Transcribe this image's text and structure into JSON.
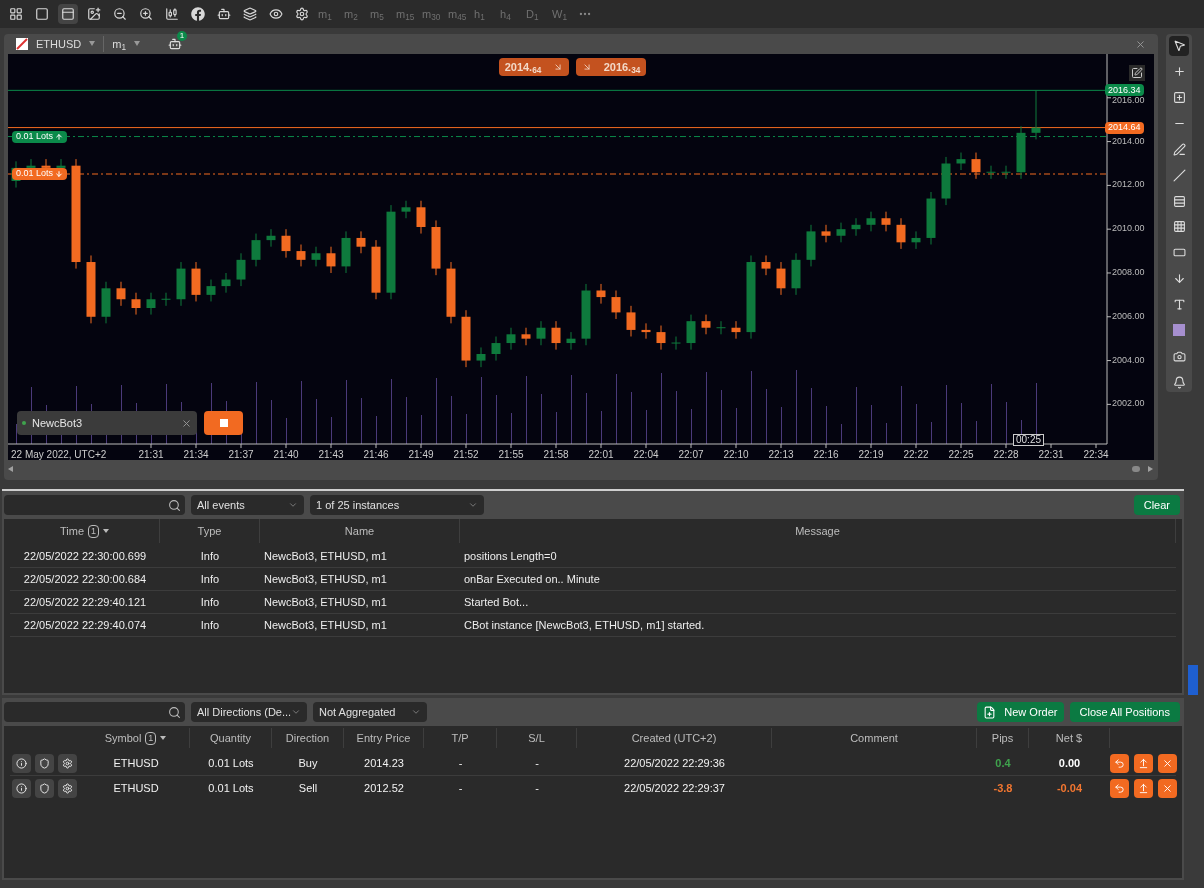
{
  "toolbar": {
    "timeframes": [
      "m$_{1}$",
      "m$_{2}$",
      "m$_{5}$",
      "m$_{15}$",
      "m$_{30}$",
      "m$_{45}$",
      "h$_{1}$",
      "h$_{4}$",
      "D$_{1}$",
      "W$_{1}$"
    ]
  },
  "chart": {
    "symbol": "ETHUSD",
    "timeframe": "m$_{1}$",
    "bot_count": "1",
    "quotes": [
      {
        "kind": "sell",
        "text": "2014.$_{64}$"
      },
      {
        "kind": "buy",
        "text": "2016.$_{34}$"
      }
    ],
    "price_labels": [
      {
        "kind": "buy",
        "text": "2016.34"
      },
      {
        "kind": "sell",
        "text": "2014.64"
      }
    ],
    "positions": [
      {
        "kind": "buy",
        "label": "0.01 Lots"
      },
      {
        "kind": "sell",
        "label": "0.01 Lots"
      }
    ],
    "date_label": "22 May 2022, UTC+2",
    "countdown": "00:25",
    "bot": {
      "name": "NewcBot3",
      "running": true
    },
    "chart_data": {
      "type": "candlestick",
      "categories": [
        null,
        null,
        null,
        null,
        null,
        null,
        null,
        null,
        null,
        "21:31",
        null,
        null,
        "21:34",
        null,
        null,
        "21:37",
        null,
        null,
        "21:40",
        null,
        null,
        "21:43",
        null,
        null,
        "21:46",
        null,
        null,
        "21:49",
        null,
        null,
        "21:52",
        null,
        null,
        "21:55",
        null,
        null,
        "21:58",
        null,
        null,
        "22:01",
        null,
        null,
        "22:04",
        null,
        null,
        "22:07",
        null,
        null,
        "22:10",
        null,
        null,
        "22:13",
        null,
        null,
        "22:16",
        null,
        null,
        "22:19",
        null,
        null,
        "22:22",
        null,
        null,
        "22:25",
        null,
        null,
        "22:28",
        null,
        null,
        "22:31",
        null,
        null,
        "22:34"
      ],
      "ohlc": [
        [
          2012.2,
          2013.1,
          2011.9,
          2012.8
        ],
        [
          2012.8,
          2013.2,
          2012.75,
          2012.9
        ],
        [
          2012.9,
          2013.2,
          2012.75,
          2012.8
        ],
        [
          2012.8,
          2013.2,
          2012.75,
          2012.9
        ],
        [
          2012.9,
          2013.2,
          2008.2,
          2008.5
        ],
        [
          2008.5,
          2008.8,
          2005.7,
          2006
        ],
        [
          2006,
          2007.6,
          2005.7,
          2007.3
        ],
        [
          2007.3,
          2007.6,
          2006.5,
          2006.8
        ],
        [
          2006.8,
          2007.1,
          2006.1,
          2006.4
        ],
        [
          2006.4,
          2007.1,
          2006.1,
          2006.8
        ],
        [
          2006.8,
          2007.1,
          2006.5,
          2006.8
        ],
        [
          2006.8,
          2008.5,
          2006.5,
          2008.2
        ],
        [
          2008.2,
          2008.5,
          2006.7,
          2007
        ],
        [
          2007,
          2007.7,
          2006.7,
          2007.4
        ],
        [
          2007.4,
          2008,
          2007.1,
          2007.7
        ],
        [
          2007.7,
          2008.9,
          2007.4,
          2008.6
        ],
        [
          2008.6,
          2009.8,
          2008.3,
          2009.5
        ],
        [
          2009.5,
          2010,
          2009.2,
          2009.7
        ],
        [
          2009.7,
          2010,
          2008.7,
          2009
        ],
        [
          2009,
          2009.3,
          2008.3,
          2008.6
        ],
        [
          2008.6,
          2009.2,
          2008.3,
          2008.9
        ],
        [
          2008.9,
          2009.2,
          2008,
          2008.3
        ],
        [
          2008.3,
          2009.9,
          2008,
          2009.6
        ],
        [
          2009.6,
          2009.9,
          2008.9,
          2009.2
        ],
        [
          2009.2,
          2009.5,
          2006.8,
          2007.1
        ],
        [
          2007.1,
          2011.1,
          2006.8,
          2010.8
        ],
        [
          2010.8,
          2011.3,
          2010.5,
          2011
        ],
        [
          2011,
          2011.3,
          2009.8,
          2010.1
        ],
        [
          2010.1,
          2010.4,
          2007.9,
          2008.2
        ],
        [
          2008.2,
          2008.5,
          2005.7,
          2006
        ],
        [
          2006,
          2006.3,
          2003.7,
          2004
        ],
        [
          2004,
          2004.6,
          2003.7,
          2004.3
        ],
        [
          2004.3,
          2005.1,
          2004,
          2004.8
        ],
        [
          2004.8,
          2005.5,
          2004.5,
          2005.2
        ],
        [
          2005.2,
          2005.5,
          2004.7,
          2005
        ],
        [
          2005,
          2005.8,
          2004.7,
          2005.5
        ],
        [
          2005.5,
          2005.8,
          2004.5,
          2004.8
        ],
        [
          2004.8,
          2005.3,
          2004.5,
          2005
        ],
        [
          2005,
          2007.5,
          2004.7,
          2007.2
        ],
        [
          2007.2,
          2007.5,
          2006.6,
          2006.9
        ],
        [
          2006.9,
          2007.2,
          2005.9,
          2006.2
        ],
        [
          2006.2,
          2006.5,
          2005.1,
          2005.4
        ],
        [
          2005.4,
          2005.7,
          2005,
          2005.3
        ],
        [
          2005.3,
          2005.6,
          2004.5,
          2004.8
        ],
        [
          2004.8,
          2005.1,
          2004.5,
          2004.8
        ],
        [
          2004.8,
          2006.1,
          2004.5,
          2005.8
        ],
        [
          2005.8,
          2006.1,
          2005.2,
          2005.5
        ],
        [
          2005.5,
          2005.8,
          2005.2,
          2005.5
        ],
        [
          2005.5,
          2005.8,
          2005,
          2005.3
        ],
        [
          2005.3,
          2008.8,
          2005,
          2008.5
        ],
        [
          2008.5,
          2008.8,
          2007.9,
          2008.2
        ],
        [
          2008.2,
          2008.5,
          2007,
          2007.3
        ],
        [
          2007.3,
          2008.9,
          2007,
          2008.6
        ],
        [
          2008.6,
          2010.2,
          2008.3,
          2009.9
        ],
        [
          2009.9,
          2010.2,
          2009.4,
          2009.7
        ],
        [
          2009.7,
          2010.3,
          2009.4,
          2010
        ],
        [
          2010,
          2010.5,
          2009.7,
          2010.2
        ],
        [
          2010.2,
          2010.8,
          2009.9,
          2010.5
        ],
        [
          2010.5,
          2010.8,
          2009.9,
          2010.2
        ],
        [
          2010.2,
          2010.5,
          2009.1,
          2009.4
        ],
        [
          2009.4,
          2009.9,
          2009.1,
          2009.6
        ],
        [
          2009.6,
          2011.7,
          2009.3,
          2011.4
        ],
        [
          2011.4,
          2013.3,
          2011.1,
          2013
        ],
        [
          2013,
          2013.5,
          2012.7,
          2013.2
        ],
        [
          2013.2,
          2013.5,
          2012.3,
          2012.6
        ],
        [
          2012.6,
          2012.9,
          2012.3,
          2012.6
        ],
        [
          2012.6,
          2012.9,
          2012.3,
          2012.6
        ],
        [
          2012.6,
          2014.7,
          2012.3,
          2014.4
        ],
        [
          2014.4,
          2016.34,
          2014.1,
          2014.64
        ],
        null,
        null,
        null,
        null
      ],
      "ylim": [
        2000.19,
        2018
      ],
      "yticks": [
        {
          "value": 2016,
          "label": "2016.00"
        },
        {
          "value": 2014,
          "label": "2014.00"
        },
        {
          "value": 2012,
          "label": "2012.00"
        },
        {
          "value": 2010,
          "label": "2010.00"
        },
        {
          "value": 2008,
          "label": "2008.00"
        },
        {
          "value": 2006,
          "label": "2006.00"
        },
        {
          "value": 2004,
          "label": "2004.00"
        },
        {
          "value": 2002,
          "label": "2002.00"
        }
      ]
    }
  },
  "tools": [
    {
      "kind": "pointer",
      "selected": true
    },
    {
      "kind": "crosshair",
      "selected": false
    },
    {
      "kind": "zoom-box",
      "selected": false
    },
    {
      "kind": "line",
      "selected": false
    },
    {
      "kind": "pen",
      "selected": false
    },
    {
      "kind": "fan",
      "selected": false
    },
    {
      "kind": "channel",
      "selected": false
    },
    {
      "kind": "grid",
      "selected": false
    },
    {
      "kind": "rectangle",
      "selected": false
    },
    {
      "kind": "arrow",
      "selected": false
    },
    {
      "kind": "text",
      "selected": false
    },
    {
      "kind": "swatch",
      "selected": false
    },
    {
      "kind": "camera",
      "selected": false
    },
    {
      "kind": "bell",
      "selected": false
    }
  ],
  "log": {
    "filters": [
      "All events",
      "1 of 25 instances"
    ],
    "clear": "Clear",
    "columns": [
      {
        "label": "Time",
        "sort": "1"
      },
      {
        "label": "Type"
      },
      {
        "label": "Name"
      },
      {
        "label": "Message"
      }
    ],
    "rows": [
      [
        "22/05/2022 22:30:00.699",
        "Info",
        "NewcBot3, ETHUSD, m1",
        "positions Length=0"
      ],
      [
        "22/05/2022 22:30:00.684",
        "Info",
        "NewcBot3, ETHUSD, m1",
        "onBar Executed on.. Minute"
      ],
      [
        "22/05/2022 22:29:40.121",
        "Info",
        "NewcBot3, ETHUSD, m1",
        "Started Bot..."
      ],
      [
        "22/05/2022 22:29:40.074",
        "Info",
        "NewcBot3, ETHUSD, m1",
        "CBot instance [NewcBot3, ETHUSD, m1] started."
      ]
    ]
  },
  "positions": {
    "filters": [
      "All Directions (De...",
      "Not Aggregated"
    ],
    "new_order": "New Order",
    "close_all": "Close All Positions",
    "columns": [
      {
        "label": "Symbol",
        "sort": "1"
      },
      {
        "label": "Quantity"
      },
      {
        "label": "Direction"
      },
      {
        "label": "Entry Price"
      },
      {
        "label": "T/P"
      },
      {
        "label": "S/L"
      },
      {
        "label": "Created (UTC+2)"
      },
      {
        "label": "Comment"
      },
      {
        "label": "Pips"
      },
      {
        "label": "Net $"
      }
    ],
    "rows": [
      {
        "symbol": "ETHUSD",
        "quantity": "0.01 Lots",
        "direction": "Buy",
        "entry": "2014.23",
        "tp": "-",
        "sl": "-",
        "created": "22/05/2022 22:29:36",
        "pips": {
          "text": "0.4",
          "color": "#3fa34d"
        },
        "net": {
          "text": "0.00",
          "color": "#ffffff"
        }
      },
      {
        "symbol": "ETHUSD",
        "quantity": "0.01 Lots",
        "direction": "Sell",
        "entry": "2012.52",
        "tp": "-",
        "sl": "-",
        "created": "22/05/2022 22:29:37",
        "pips": {
          "text": "-3.8",
          "color": "#f27630"
        },
        "net": {
          "text": "-0.04",
          "color": "#f27630"
        }
      }
    ]
  }
}
